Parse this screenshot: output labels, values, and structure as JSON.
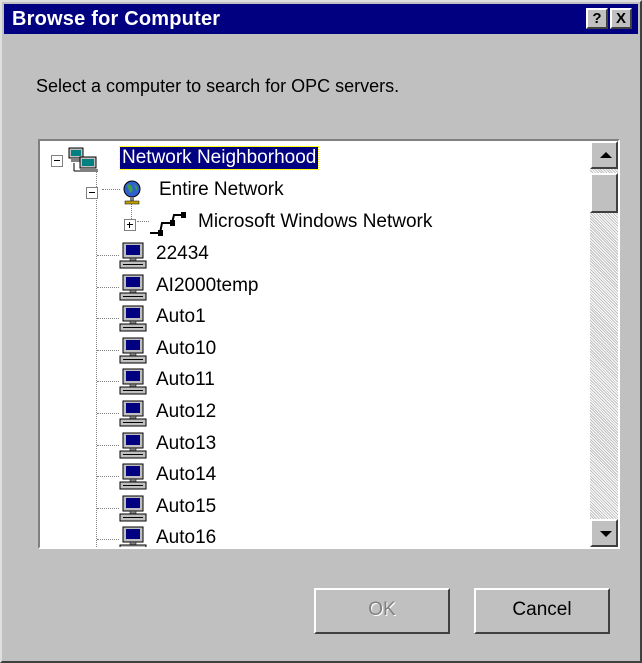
{
  "window": {
    "title": "Browse for Computer",
    "help_label": "?",
    "close_label": "X"
  },
  "instruction": "Select a computer to search for OPC servers.",
  "tree": {
    "root": "Network Neighborhood",
    "entire_network": "Entire Network",
    "microsoft_network": "Microsoft Windows Network",
    "computers": [
      "22434",
      "AI2000temp",
      "Auto1",
      "Auto10",
      "Auto11",
      "Auto12",
      "Auto13",
      "Auto14",
      "Auto15",
      "Auto16"
    ],
    "selected": "Network Neighborhood"
  },
  "buttons": {
    "ok": "OK",
    "ok_enabled": false,
    "cancel": "Cancel"
  },
  "icons": {
    "root": "network-neighborhood-icon",
    "entire_network": "globe-network-icon",
    "microsoft_network": "network-cable-icon",
    "computer": "computer-icon"
  }
}
